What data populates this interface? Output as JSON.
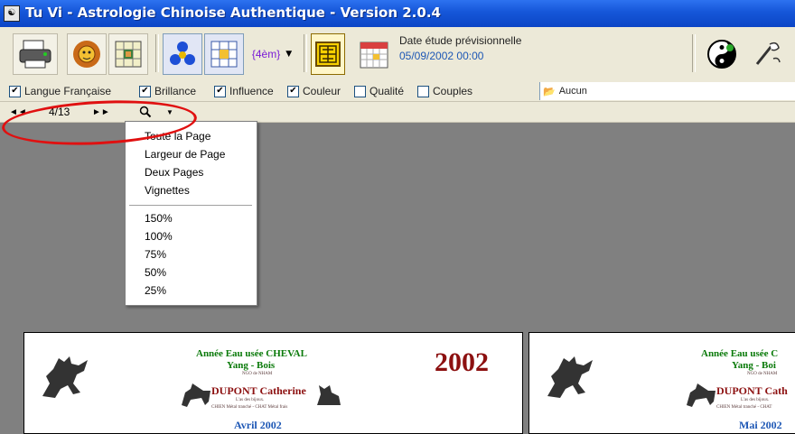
{
  "window": {
    "title": "Tu Vi - Astrologie Chinoise Authentique - Version 2.0.4"
  },
  "toolbar": {
    "fourth_label": "{4èm}",
    "date_label": "Date étude prévisionnelle",
    "date_value": "05/09/2002 00:00"
  },
  "options": {
    "checks": [
      {
        "label": "Langue Française",
        "checked": true
      },
      {
        "label": "Brillance",
        "checked": true
      },
      {
        "label": "Influence",
        "checked": true
      },
      {
        "label": "Couleur",
        "checked": true
      },
      {
        "label": "Qualité",
        "checked": false
      },
      {
        "label": "Couples",
        "checked": false
      }
    ],
    "combo_value": "Aucun"
  },
  "nav": {
    "page_indicator": "4/13",
    "first": "◄◄",
    "last": "►►"
  },
  "zoom_menu": {
    "items": [
      "Toute la Page",
      "Largeur de Page",
      "Deux Pages",
      "Vignettes"
    ],
    "zooms": [
      "150%",
      "100%",
      "75%",
      "50%",
      "25%"
    ]
  },
  "pages": [
    {
      "title1": "Année Eau usée CHEVAL",
      "title2": "Yang - Bois",
      "small1": "NGO de NHAM",
      "name": "DUPONT Catherine",
      "small2": "L'as des bijoux.",
      "small3": "CHIEN Métal tranché - CHAT Métal frais",
      "year": "2002",
      "month": "Avril 2002"
    },
    {
      "title1": "Année Eau usée C",
      "title2": "Yang - Boi",
      "small1": "NGO de NHAM",
      "name": "DUPONT Cath",
      "small2": "L'as des bijoux.",
      "small3": "CHIEN Métal tranché - CHAT",
      "month": "Mai 2002"
    }
  ]
}
